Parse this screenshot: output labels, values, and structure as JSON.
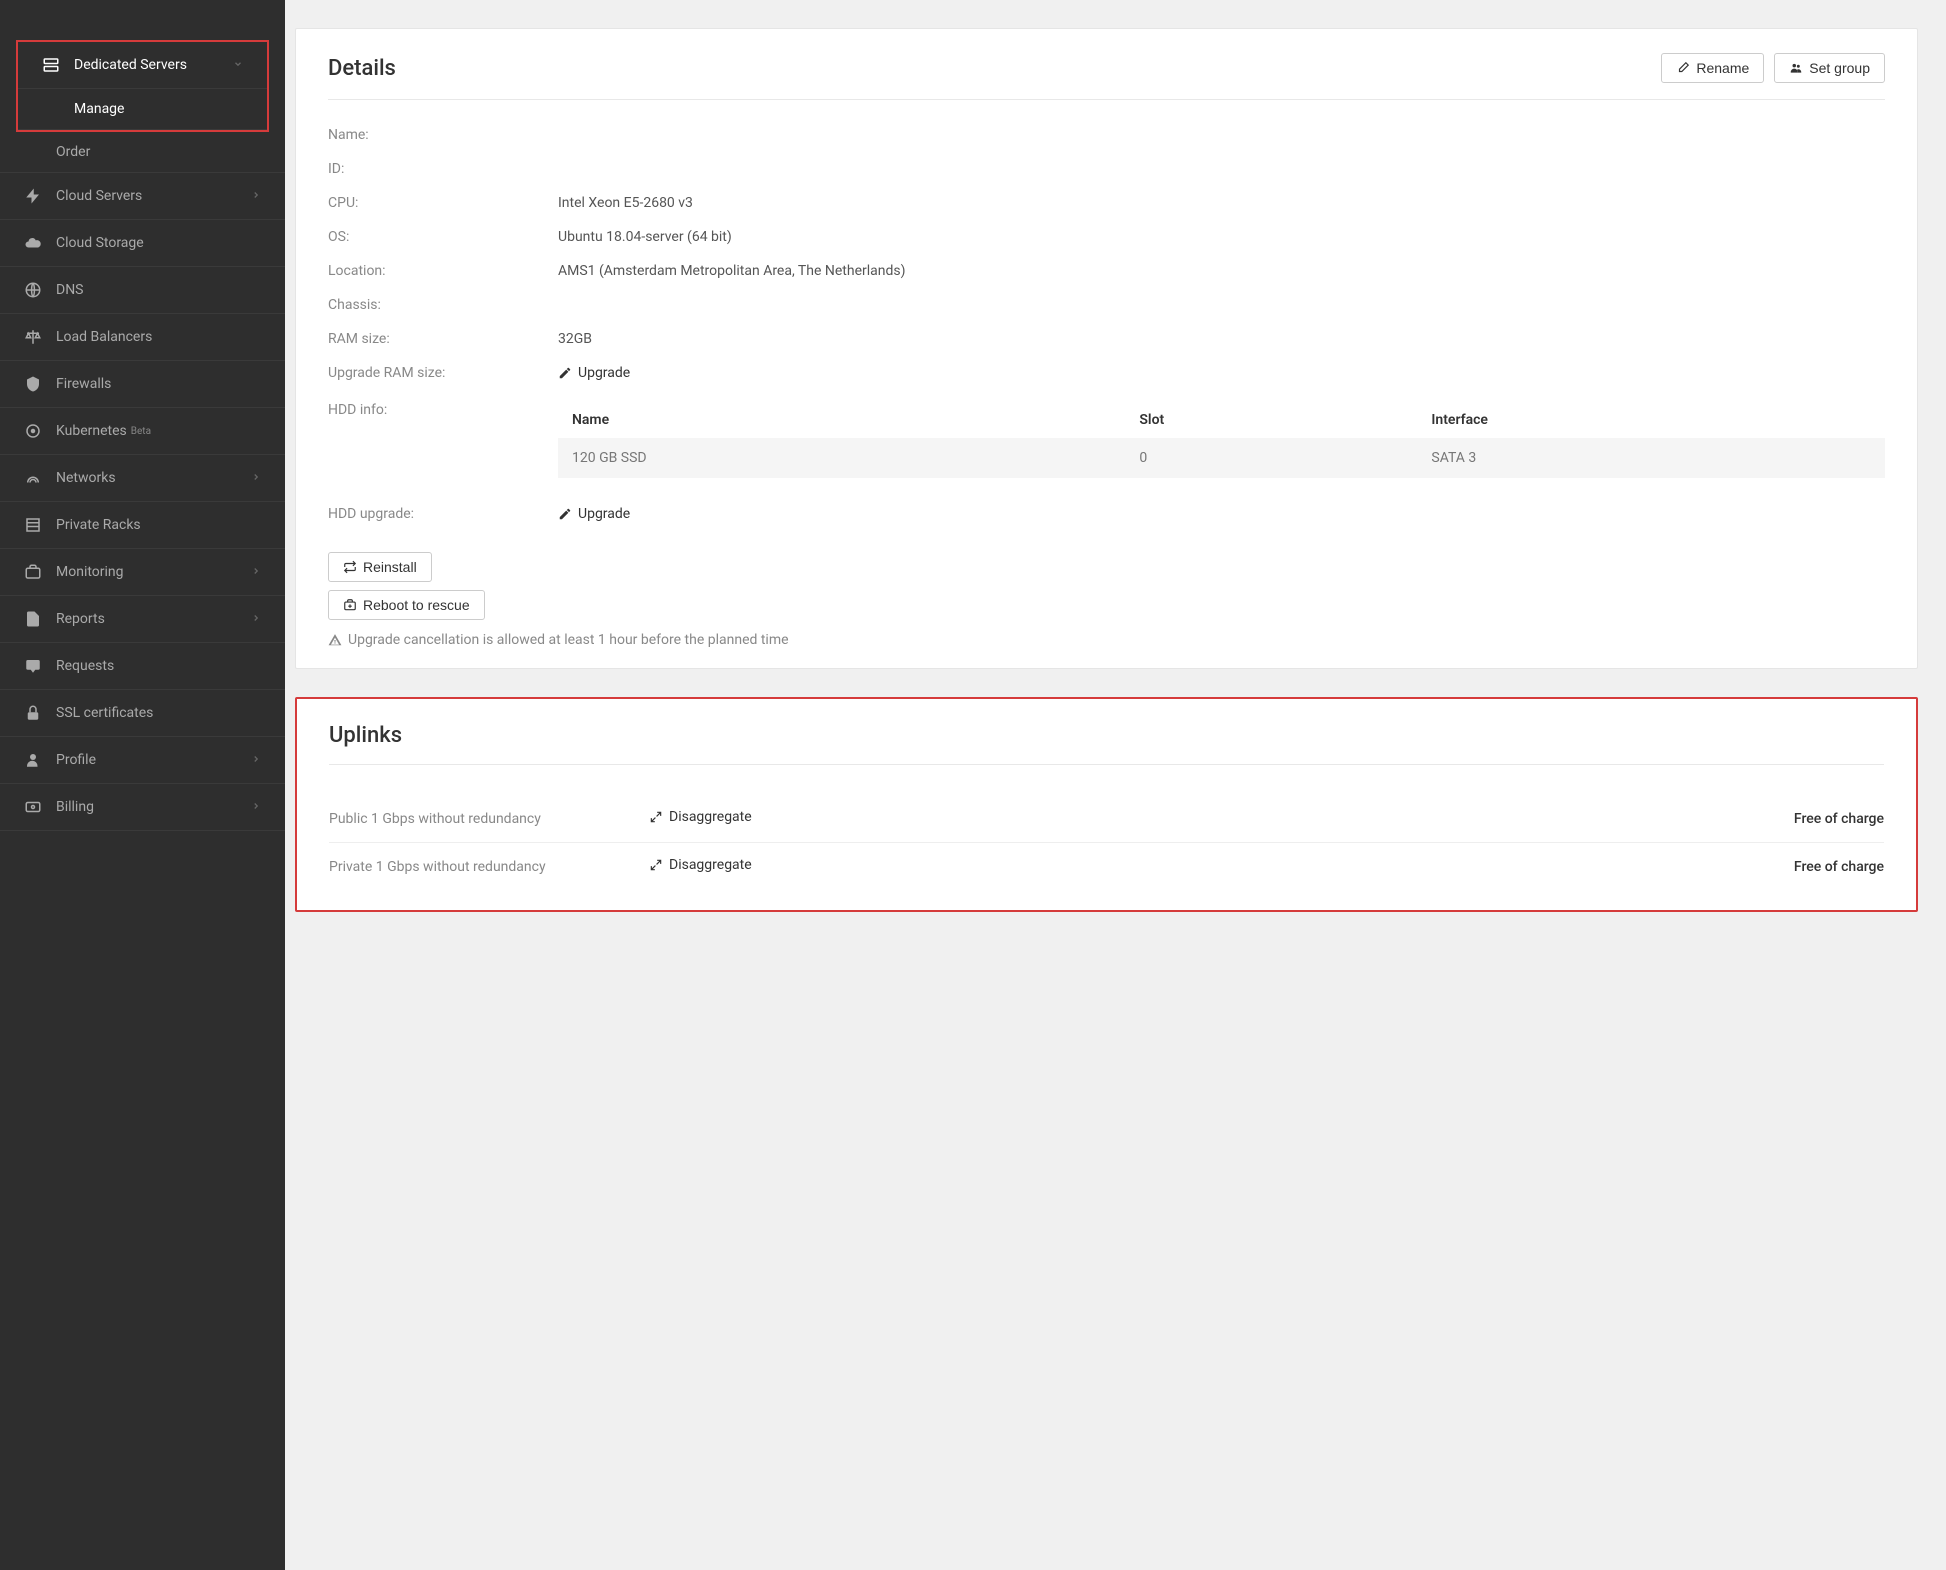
{
  "sidebar": {
    "items": [
      {
        "icon": "server",
        "label": "Dedicated Servers",
        "expanded": true,
        "children": [
          {
            "label": "Manage",
            "active": true
          },
          {
            "label": "Order",
            "active": false
          }
        ]
      },
      {
        "icon": "bolt",
        "label": "Cloud Servers",
        "chevron": true
      },
      {
        "icon": "cloud",
        "label": "Cloud Storage"
      },
      {
        "icon": "globe",
        "label": "DNS"
      },
      {
        "icon": "balance",
        "label": "Load Balancers"
      },
      {
        "icon": "shield",
        "label": "Firewalls"
      },
      {
        "icon": "k8s",
        "label": "Kubernetes",
        "badge": "Beta"
      },
      {
        "icon": "signal",
        "label": "Networks",
        "chevron": true
      },
      {
        "icon": "rack",
        "label": "Private Racks"
      },
      {
        "icon": "briefcase",
        "label": "Monitoring",
        "chevron": true
      },
      {
        "icon": "file",
        "label": "Reports",
        "chevron": true
      },
      {
        "icon": "comment",
        "label": "Requests"
      },
      {
        "icon": "lock",
        "label": "SSL certificates"
      },
      {
        "icon": "user",
        "label": "Profile",
        "chevron": true
      },
      {
        "icon": "billing",
        "label": "Billing",
        "chevron": true
      }
    ]
  },
  "details": {
    "title": "Details",
    "rename_label": "Rename",
    "setgroup_label": "Set group",
    "rows": {
      "name_label": "Name:",
      "name_value": "",
      "id_label": "ID:",
      "id_value": "",
      "cpu_label": "CPU:",
      "cpu_value": "Intel Xeon E5-2680 v3",
      "os_label": "OS:",
      "os_value": "Ubuntu 18.04-server (64 bit)",
      "location_label": "Location:",
      "location_value": "AMS1 (Amsterdam Metropolitan Area, The Netherlands)",
      "chassis_label": "Chassis:",
      "chassis_value": "",
      "ram_label": "RAM size:",
      "ram_value": "32GB",
      "upgrade_ram_label": "Upgrade RAM size:",
      "upgrade_link": "Upgrade",
      "hdd_info_label": "HDD info:",
      "hdd_upgrade_label": "HDD upgrade:"
    },
    "hdd_table": {
      "headers": {
        "name": "Name",
        "slot": "Slot",
        "interface": "Interface"
      },
      "row": {
        "name": "120 GB SSD",
        "slot": "0",
        "interface": "SATA 3"
      }
    },
    "reinstall_label": "Reinstall",
    "reboot_label": "Reboot to rescue",
    "footnote": "Upgrade cancellation is allowed at least 1 hour before the planned time"
  },
  "uplinks": {
    "title": "Uplinks",
    "rows": [
      {
        "name": "Public 1 Gbps without redundancy",
        "action": "Disaggregate",
        "price": "Free of charge"
      },
      {
        "name": "Private 1 Gbps without redundancy",
        "action": "Disaggregate",
        "price": "Free of charge"
      }
    ]
  }
}
